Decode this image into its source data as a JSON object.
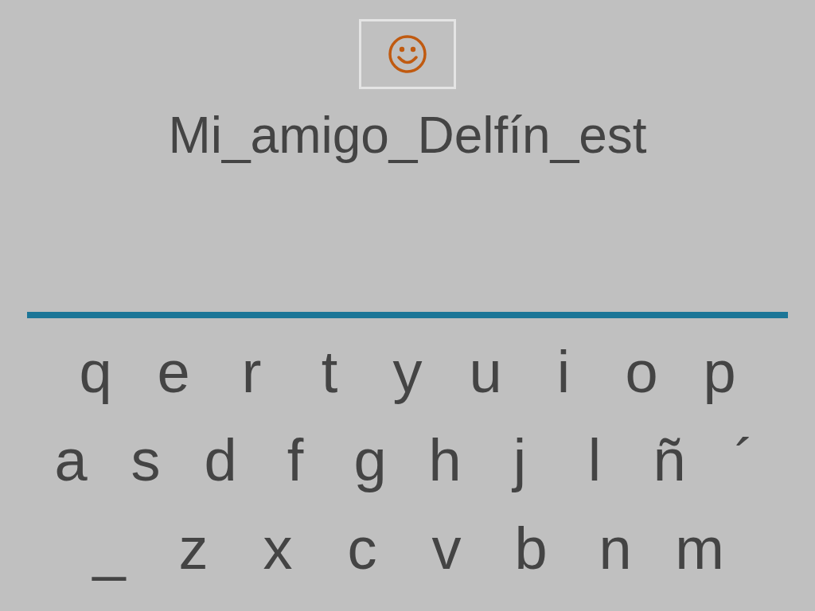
{
  "answer": {
    "text": "Mi_amigo_Delfín_est"
  },
  "keyboard": {
    "rows": [
      [
        "q",
        "e",
        "r",
        "t",
        "y",
        "u",
        "i",
        "o",
        "p"
      ],
      [
        "a",
        "s",
        "d",
        "f",
        "g",
        "h",
        "j",
        "l",
        "ñ",
        "´"
      ],
      [
        "_",
        "z",
        "x",
        "c",
        "v",
        "b",
        "n",
        "m"
      ]
    ]
  }
}
